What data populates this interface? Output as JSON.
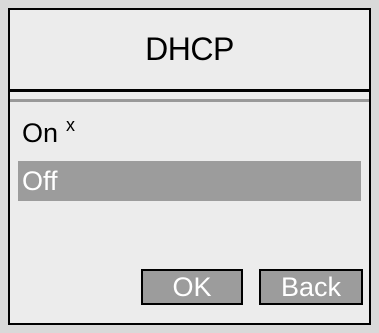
{
  "dialog": {
    "title": "DHCP",
    "options": [
      {
        "label": "On",
        "mark": "x",
        "selected": false
      },
      {
        "label": "Off",
        "selected": true
      }
    ],
    "buttons": {
      "ok_label": "OK",
      "back_label": "Back"
    },
    "colors": {
      "background": "#ececec",
      "highlight": "#9c9c9c",
      "border": "#000000"
    }
  }
}
